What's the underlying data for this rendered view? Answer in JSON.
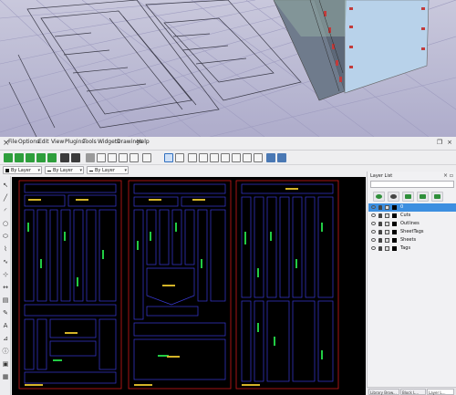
{
  "menu": {
    "items": [
      "File",
      "Options",
      "Edit",
      "View",
      "Plugins",
      "Tools",
      "Widgets",
      "Drawings",
      "Help"
    ]
  },
  "layer_combos": [
    {
      "label": "By Layer"
    },
    {
      "label": "By Layer"
    },
    {
      "label": "By Layer"
    }
  ],
  "layer_panel": {
    "title": "Layer List",
    "layers": [
      {
        "name": "0",
        "selected": true
      },
      {
        "name": "Cuts",
        "selected": false
      },
      {
        "name": "Outlines",
        "selected": false
      },
      {
        "name": "SheetTags",
        "selected": false
      },
      {
        "name": "Sheets",
        "selected": false
      },
      {
        "name": "Tags",
        "selected": false
      }
    ],
    "tabs": [
      "Library Brow...",
      "Block L...",
      "Layer L..."
    ]
  },
  "colors": {
    "canvas_bg": "#000000",
    "sheet_border": "#cc1a1a",
    "part_outline": "#3a3ad8",
    "cut_mark": "#22cc44",
    "tag_text": "#d4b428",
    "selection": "#3d8fe0"
  },
  "icons": {
    "window_close": "close-icon",
    "tools": [
      "select-icon",
      "line-icon",
      "arc-icon",
      "circle-icon",
      "ellipse-icon",
      "polyline-icon",
      "spline-icon",
      "text-icon",
      "dimension-icon",
      "hatch-icon",
      "modify-icon",
      "snap-icon",
      "measure-icon",
      "info-icon"
    ]
  }
}
